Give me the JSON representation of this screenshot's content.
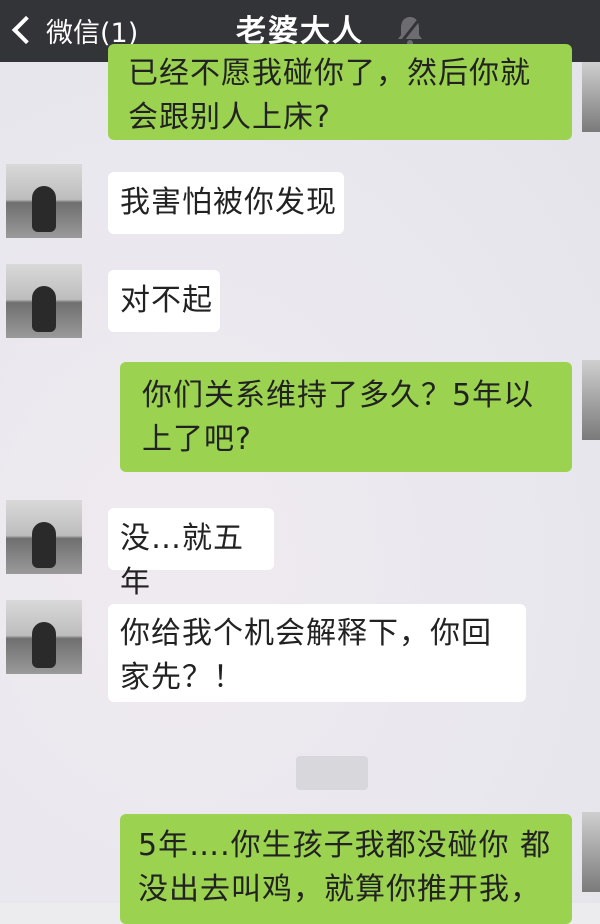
{
  "header": {
    "back_label": "微信(1)",
    "title": "老婆大人"
  },
  "icons": {
    "back": "chevron-left-icon",
    "mute": "mute-icon",
    "avatar": "contact-avatar"
  },
  "colors": {
    "header_bg": "#333438",
    "outgoing_bubble": "#9bd350",
    "incoming_bubble": "#ffffff"
  },
  "messages": [
    {
      "side": "out",
      "text": "已经不愿我碰你了，然后你就会跟别人上床?"
    },
    {
      "side": "in",
      "text": "我害怕被你发现"
    },
    {
      "side": "in",
      "text": "对不起"
    },
    {
      "side": "out",
      "text": "你们关系维持了多久？5年以上了吧?"
    },
    {
      "side": "in",
      "text": "没…就五年"
    },
    {
      "side": "in",
      "text": "你给我个机会解释下，你回家先？！"
    },
    {
      "side": "out",
      "text": "5年….你生孩子我都没碰你 都没出去叫鸡，就算你推开我，"
    }
  ]
}
